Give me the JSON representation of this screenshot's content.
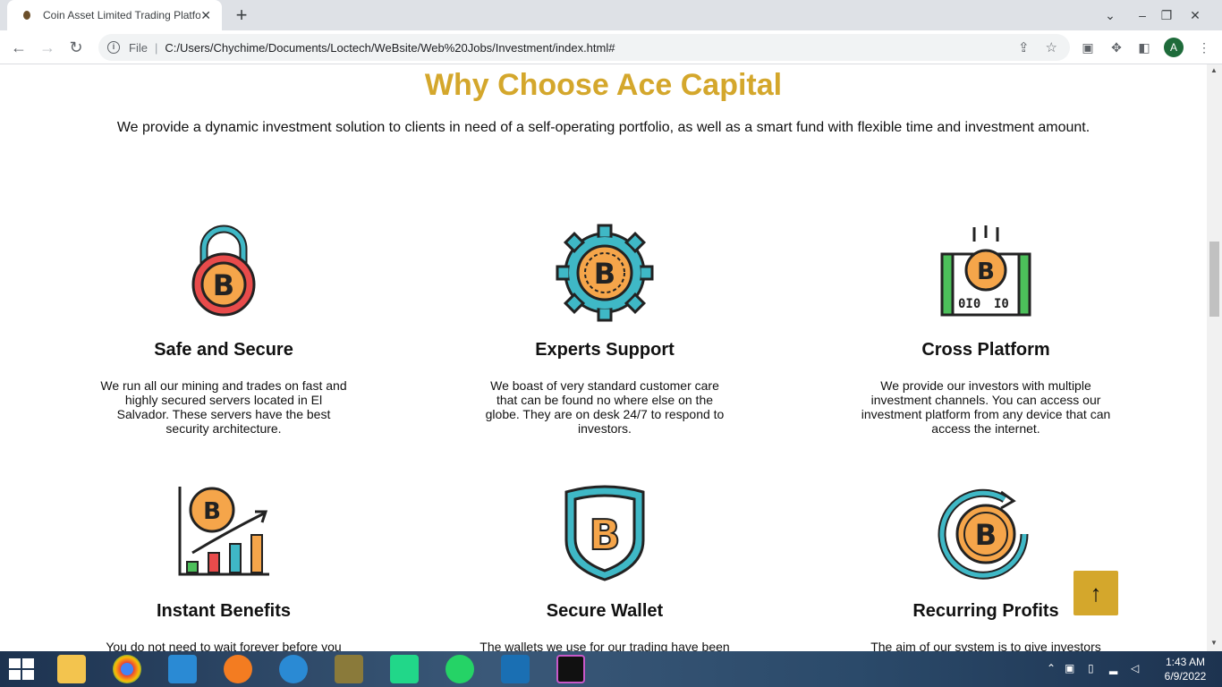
{
  "browser": {
    "tab_title": "Coin Asset Limited Trading Platfo",
    "tab_close": "✕",
    "new_tab": "+",
    "file_label": "File",
    "url": "C:/Users/Chychime/Documents/Loctech/WeBsite/Web%20Jobs/Investment/index.html#",
    "profile_initial": "A"
  },
  "page": {
    "heading": "Why Choose Ace Capital",
    "intro": "We provide a dynamic investment solution to clients in need of a self-operating portfolio, as well as a smart fund with flexible time and investment amount.",
    "features": [
      {
        "title": "Safe and Secure",
        "text": "We run all our mining and trades on fast and highly secured servers located in El Salvador. These servers have the best security architecture.",
        "icon": "bitcoin-lock-icon"
      },
      {
        "title": "Experts Support",
        "text": "We boast of very standard customer care that can be found no where else on the globe. They are on desk 24/7 to respond to investors.",
        "icon": "bitcoin-gear-icon"
      },
      {
        "title": "Cross Platform",
        "text": "We provide our investors with multiple investment channels. You can access our investment platform from any device that can access the internet.",
        "icon": "bitcoin-screen-icon"
      },
      {
        "title": "Instant Benefits",
        "text": "You do not need to wait forever before you can",
        "icon": "bitcoin-growth-chart-icon"
      },
      {
        "title": "Secure Wallet",
        "text": "The wallets we use for our trading have been",
        "icon": "bitcoin-shield-icon"
      },
      {
        "title": "Recurring Profits",
        "text": "The aim of our system is to give investors",
        "icon": "bitcoin-refresh-icon"
      }
    ],
    "back_to_top": "↑"
  },
  "taskbar": {
    "time": "1:43 AM",
    "date": "6/9/2022"
  },
  "colors": {
    "accent": "#d4a72c",
    "orange": "#f5a54a",
    "teal": "#3fb8c6",
    "red": "#e84b4b",
    "green": "#4cbf5a"
  }
}
